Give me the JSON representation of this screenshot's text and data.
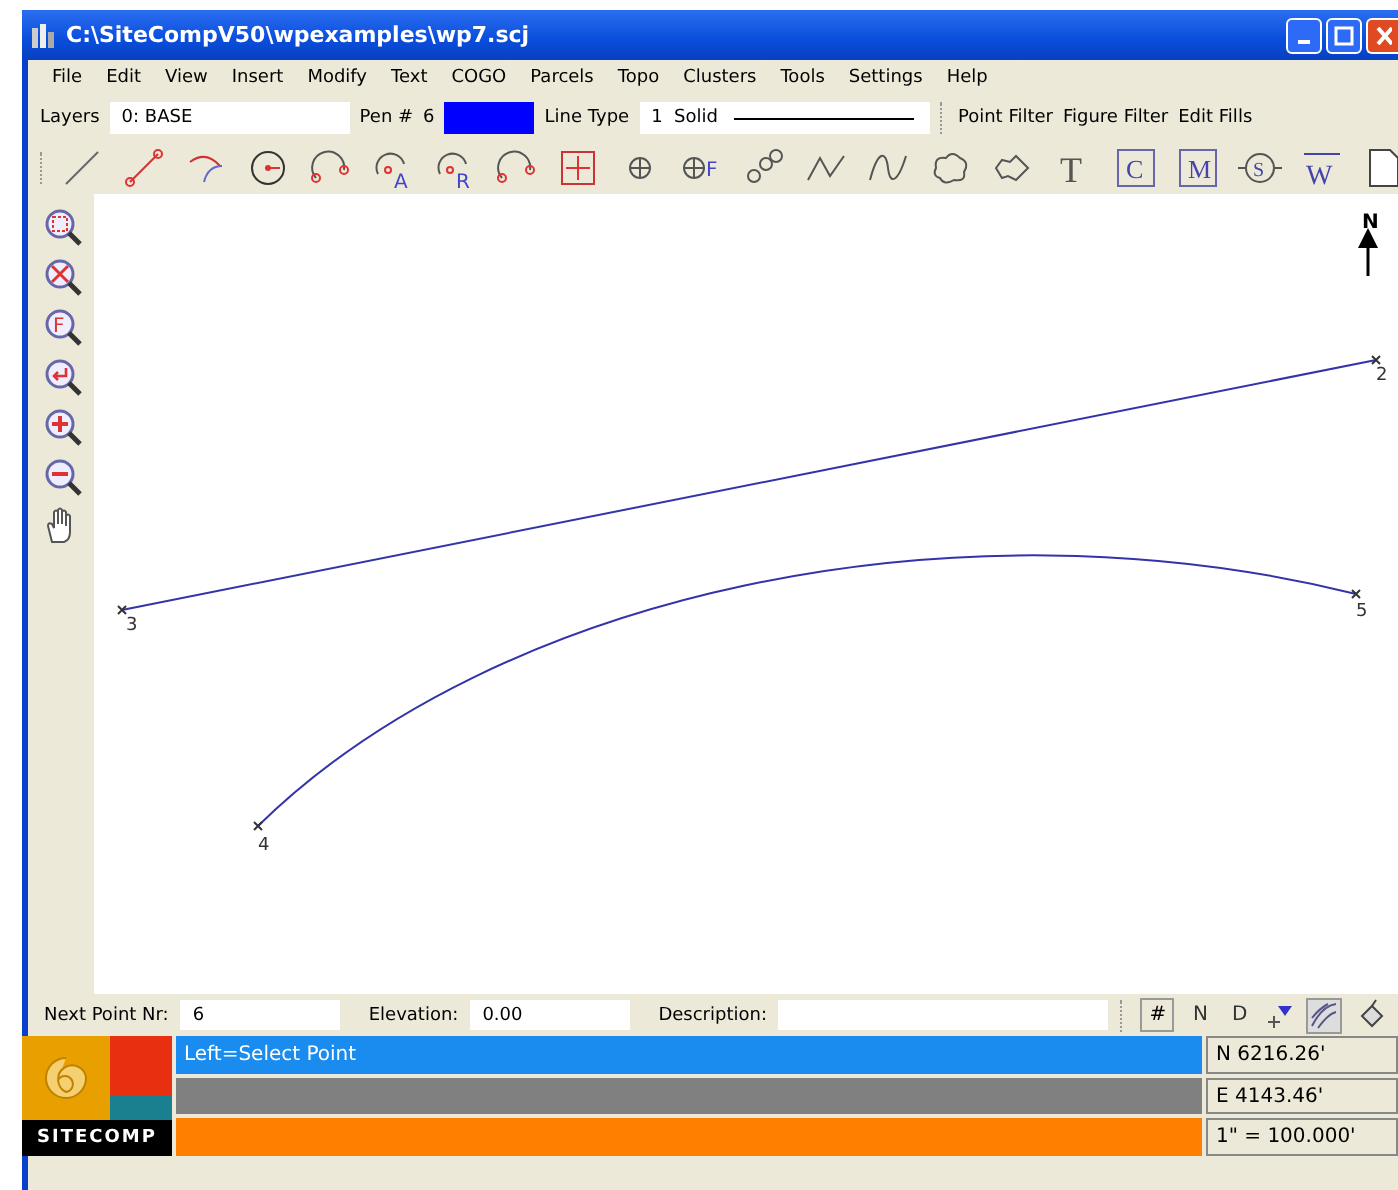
{
  "window": {
    "title": "C:\\SiteCompV50\\wpexamples\\wp7.scj"
  },
  "menu": [
    "File",
    "Edit",
    "View",
    "Insert",
    "Modify",
    "Text",
    "COGO",
    "Parcels",
    "Topo",
    "Clusters",
    "Tools",
    "Settings",
    "Help"
  ],
  "layer_bar": {
    "layers_label": "Layers",
    "layer": "0: BASE",
    "pen_label": "Pen #",
    "pen": "6",
    "line_type_label": "Line Type",
    "line_type_number": "1",
    "line_type": "Solid",
    "filters": [
      "Point Filter",
      "Figure Filter",
      "Edit Fills"
    ]
  },
  "draw_tools": [
    {
      "kind": "line"
    },
    {
      "kind": "segment"
    },
    {
      "kind": "arc"
    },
    {
      "kind": "circle"
    },
    {
      "kind": "arc3"
    },
    {
      "kind": "arc-glyph",
      "glyph": "A"
    },
    {
      "kind": "arc-glyph",
      "glyph": "R"
    },
    {
      "kind": "curve"
    },
    {
      "kind": "grid"
    },
    {
      "kind": "point"
    },
    {
      "kind": "point-glyph",
      "glyph": "F"
    },
    {
      "kind": "points"
    },
    {
      "kind": "zigzag"
    },
    {
      "kind": "wave"
    },
    {
      "kind": "cloud"
    },
    {
      "kind": "cloud2"
    },
    {
      "kind": "text",
      "glyph": "T"
    },
    {
      "kind": "box-glyph",
      "glyph": "C"
    },
    {
      "kind": "box-glyph",
      "glyph": "M"
    },
    {
      "kind": "circle-glyph",
      "glyph": "S"
    },
    {
      "kind": "under-glyph",
      "glyph": "W"
    },
    {
      "kind": "page"
    }
  ],
  "view_tools": [
    {
      "kind": "zoom-window"
    },
    {
      "kind": "zoom-extents"
    },
    {
      "kind": "zoom-glyph",
      "glyph": "F"
    },
    {
      "kind": "zoom-previous"
    },
    {
      "kind": "zoom-in"
    },
    {
      "kind": "zoom-out"
    },
    {
      "kind": "pan"
    }
  ],
  "canvas": {
    "north_label": "N",
    "points": [
      {
        "label": "3"
      },
      {
        "label": "2"
      },
      {
        "label": "4"
      },
      {
        "label": "5"
      }
    ]
  },
  "point_bar": {
    "next_label": "Next Point Nr:",
    "next": "6",
    "elevation_label": "Elevation:",
    "elevation": "0.00",
    "description_label": "Description:",
    "buttons": [
      "#",
      "N",
      "D"
    ]
  },
  "status": {
    "logo": "SITECOMP",
    "prompt": "Left=Select Point",
    "northing": "N 6216.26'",
    "easting": "E 4143.46'",
    "scale": "1\" = 100.000'"
  }
}
